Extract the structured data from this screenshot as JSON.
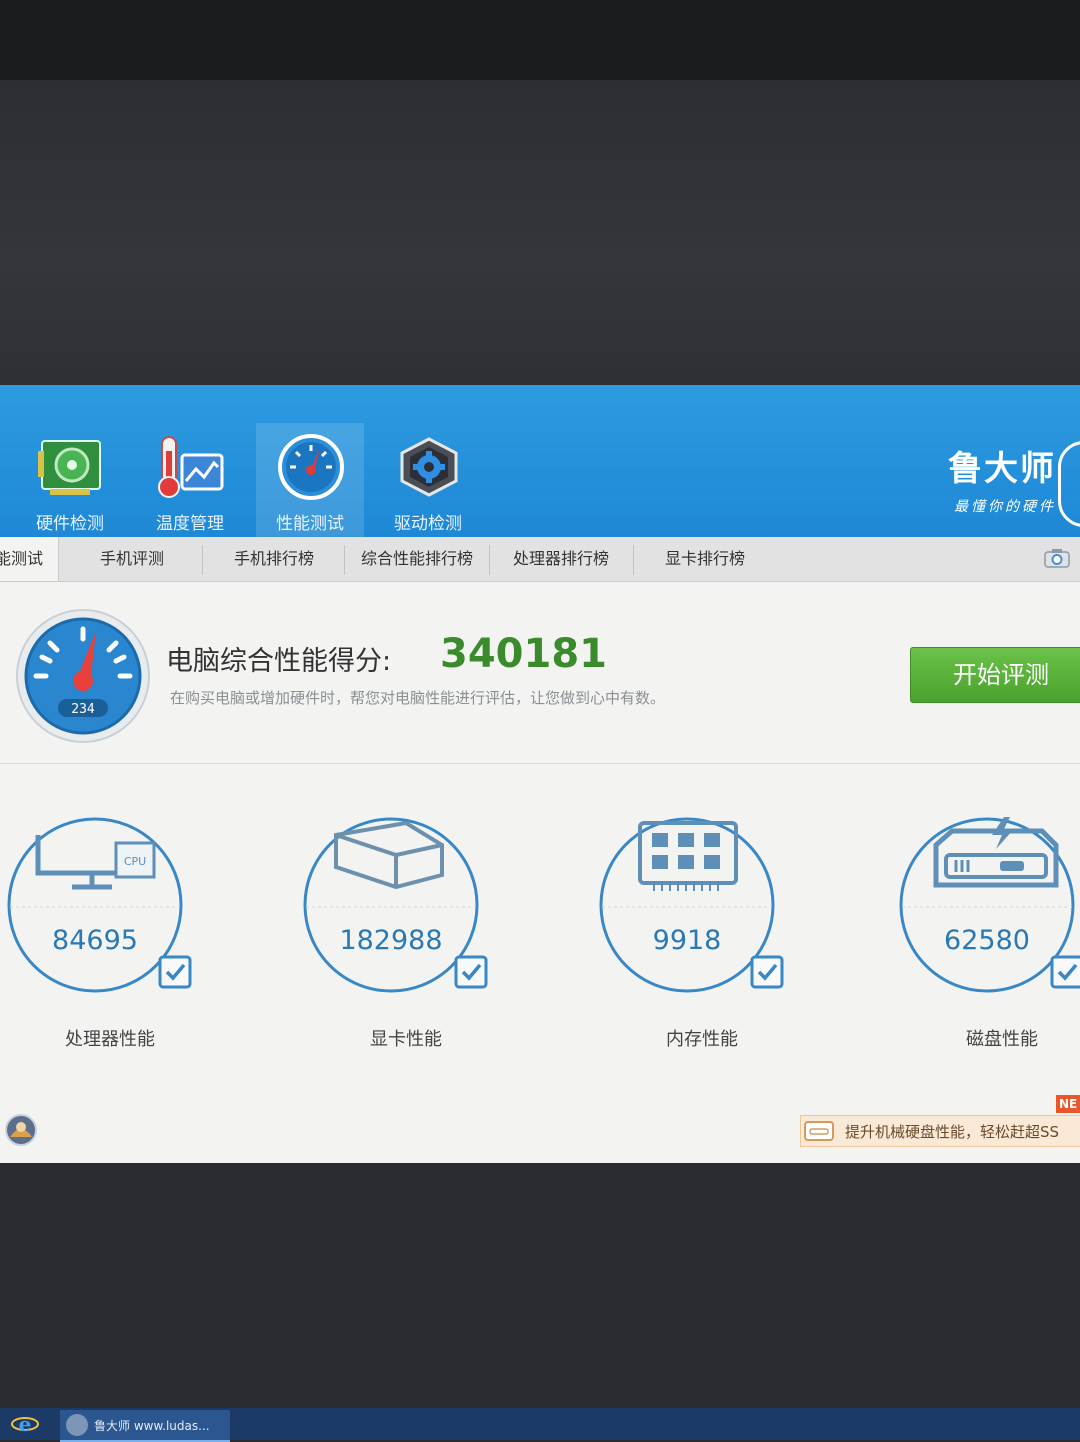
{
  "header": {
    "nav": [
      {
        "label": "硬件检测",
        "icon": "hardware-card-icon"
      },
      {
        "label": "温度管理",
        "icon": "thermometer-icon"
      },
      {
        "label": "性能测试",
        "icon": "speedometer-icon"
      },
      {
        "label": "驱动检测",
        "icon": "driver-gear-icon"
      }
    ],
    "brand_name": "鲁大师",
    "brand_slogan": "最懂你的硬件"
  },
  "tabs": [
    "能测试",
    "手机评测",
    "手机排行榜",
    "综合性能排行榜",
    "处理器排行榜",
    "显卡排行榜"
  ],
  "score": {
    "label": "电脑综合性能得分:",
    "value": "340181",
    "description": "在购买电脑或增加硬件时，帮您对电脑性能进行评估，让您做到心中有数。",
    "gauge_text": "234",
    "start_button": "开始评测"
  },
  "metrics": [
    {
      "value": "84695",
      "label": "处理器性能",
      "icon": "cpu-monitor-icon",
      "chip_text": "CPU"
    },
    {
      "value": "182988",
      "label": "显卡性能",
      "icon": "gpu-cube-icon"
    },
    {
      "value": "9918",
      "label": "内存性能",
      "icon": "memory-chip-icon"
    },
    {
      "value": "62580",
      "label": "磁盘性能",
      "icon": "disk-drive-icon"
    }
  ],
  "promo": {
    "text": "提升机械硬盘性能，轻松赶超SS",
    "badge": "NE"
  },
  "taskbar": {
    "app_label": "鲁大师 www.ludas..."
  },
  "colors": {
    "header_blue": "#1e88d6",
    "score_green": "#3a8b2c",
    "value_blue": "#2a78b4",
    "button_green": "#49a22d"
  }
}
